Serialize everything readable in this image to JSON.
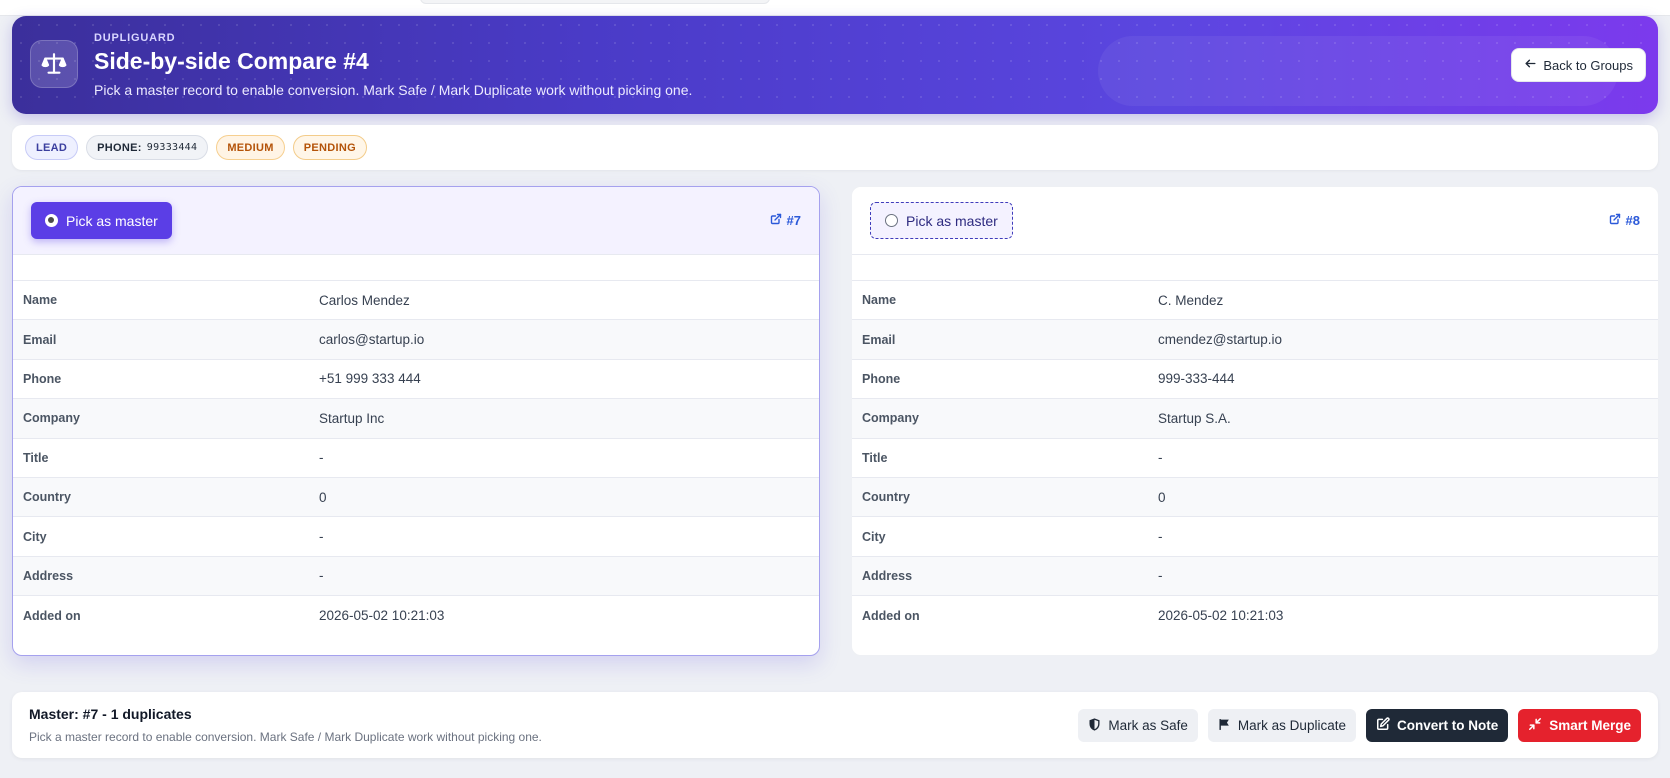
{
  "hero": {
    "kicker": "DUPLIGUARD",
    "title": "Side-by-side Compare #4",
    "subtitle": "Pick a master record to enable conversion. Mark Safe / Mark Duplicate work without picking one.",
    "icon": "scale-icon",
    "back_label": "Back to Groups"
  },
  "badges": {
    "lead": "LEAD",
    "phone_label": "PHONE:",
    "phone_value": "99333444",
    "severity": "MEDIUM",
    "status": "PENDING"
  },
  "records": [
    {
      "pick_label": "Pick as master",
      "selected": true,
      "link": "#7",
      "fields": {
        "name": "Carlos Mendez",
        "email": "carlos@startup.io",
        "phone": "+51 999 333 444",
        "company": "Startup Inc",
        "title": "-",
        "country": "0",
        "city": "-",
        "address": "-",
        "added_on": "2026-05-02 10:21:03"
      }
    },
    {
      "pick_label": "Pick as master",
      "selected": false,
      "link": "#8",
      "fields": {
        "name": "C. Mendez",
        "email": "cmendez@startup.io",
        "phone": "999-333-444",
        "company": "Startup S.A.",
        "title": "-",
        "country": "0",
        "city": "-",
        "address": "-",
        "added_on": "2026-05-02 10:21:03"
      }
    }
  ],
  "field_labels": {
    "name": "Name",
    "email": "Email",
    "phone": "Phone",
    "company": "Company",
    "title": "Title",
    "country": "Country",
    "city": "City",
    "address": "Address",
    "added_on": "Added on"
  },
  "footer": {
    "title": "Master: #7 - 1 duplicates",
    "subtitle": "Pick a master record to enable conversion. Mark Safe / Mark Duplicate work without picking one.",
    "mark_safe": "Mark as Safe",
    "mark_duplicate": "Mark as Duplicate",
    "convert_note": "Convert to Note",
    "smart_merge": "Smart Merge"
  },
  "colors": {
    "accent": "#5b3ee6",
    "hero_start": "#3b2f9b",
    "hero_end": "#7c3aed",
    "link": "#2b59d9",
    "danger": "#e5222d",
    "dark": "#1f2937"
  }
}
